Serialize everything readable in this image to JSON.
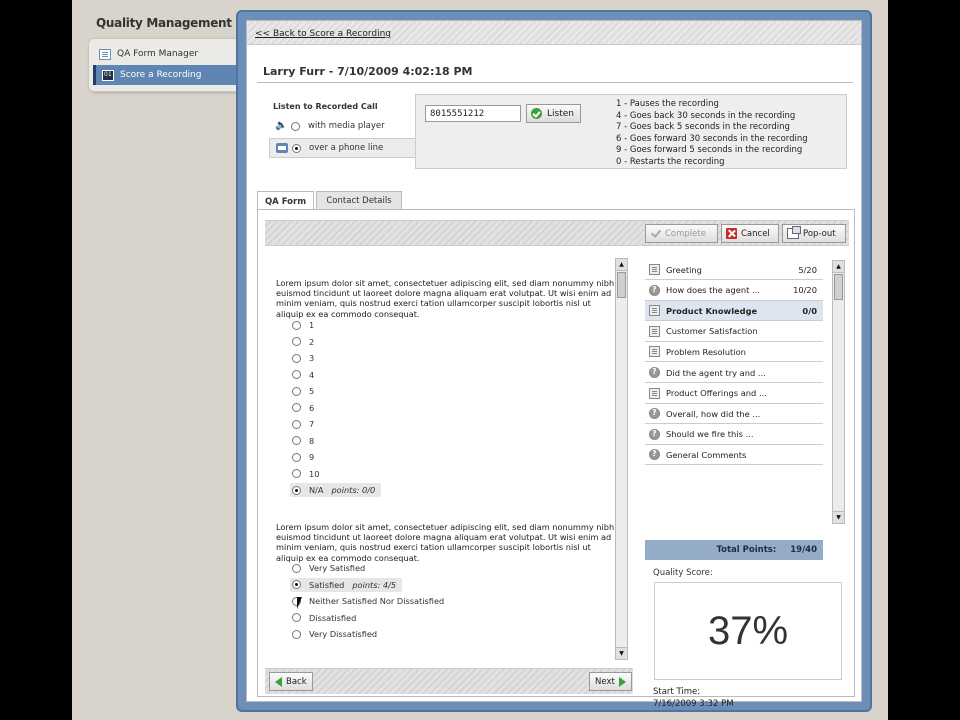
{
  "app": {
    "title": "Quality Management"
  },
  "nav": {
    "items": [
      {
        "label": "QA Form Manager",
        "active": false
      },
      {
        "label": "Score a Recording",
        "active": true
      }
    ]
  },
  "header": {
    "back_link": "<< Back to Score a Recording",
    "call_title": "Larry Furr - 7/10/2009 4:02:18 PM"
  },
  "listen": {
    "label": "Listen to  Recorded Call",
    "options": [
      {
        "label": "with media player",
        "selected": false
      },
      {
        "label": "over a phone line",
        "selected": true
      }
    ],
    "phone_number": "8015551212",
    "listen_button": "Listen",
    "keys": [
      "1 - Pauses the recording",
      "4 - Goes back 30 seconds in the recording",
      "7 - Goes back 5 seconds in the recording",
      "6 - Goes forward 30 seconds in the recording",
      "9 - Goes forward 5 seconds in the recording",
      "0 - Restarts the recording"
    ]
  },
  "tabs": [
    {
      "label": "QA Form",
      "active": true
    },
    {
      "label": "Contact Details",
      "active": false
    }
  ],
  "actions": {
    "complete": "Complete",
    "cancel": "Cancel",
    "popout": "Pop-out"
  },
  "questions": [
    {
      "text": "Lorem ipsum dolor sit amet, consectetuer adipiscing elit, sed diam nonummy nibh euismod tincidunt ut laoreet dolore magna aliquam erat volutpat. Ut wisi enim ad minim veniam, quis nostrud exerci tation ullamcorper suscipit lobortis nisl ut aliquip ex ea commodo consequat.",
      "answers": [
        "1",
        "2",
        "3",
        "4",
        "5",
        "6",
        "7",
        "8",
        "9",
        "10",
        "N/A"
      ],
      "selected_index": 10,
      "points": "points: 0/0"
    },
    {
      "text": "Lorem ipsum dolor sit amet, consectetuer adipiscing elit, sed diam nonummy nibh euismod tincidunt ut laoreet dolore magna aliquam erat volutpat. Ut wisi enim ad minim veniam, quis nostrud exerci tation ullamcorper suscipit lobortis nisl ut aliquip ex ea commodo consequat.",
      "answers": [
        "Very Satisfied",
        "Satisfied",
        "Neither Satisfied Nor Dissatisfied",
        "Dissatisfied",
        "Very Dissatisfied"
      ],
      "selected_index": 1,
      "points": "points: 4/5"
    }
  ],
  "sections": [
    {
      "name": "Greeting",
      "score": "5/20",
      "icon": "list-icon",
      "active": false
    },
    {
      "name": "How does the agent ...",
      "score": "10/20",
      "icon": "help-icon",
      "active": false
    },
    {
      "name": "Product Knowledge",
      "score": "0/0",
      "icon": "list-icon",
      "active": true
    },
    {
      "name": "Customer Satisfaction",
      "score": "",
      "icon": "list-icon",
      "active": false
    },
    {
      "name": "Problem Resolution",
      "score": "",
      "icon": "list-icon",
      "active": false
    },
    {
      "name": "Did the agent try and ...",
      "score": "",
      "icon": "help-icon",
      "active": false
    },
    {
      "name": "Product Offerings and ...",
      "score": "",
      "icon": "list-icon",
      "active": false
    },
    {
      "name": "Overall, how did the ...",
      "score": "",
      "icon": "help-icon",
      "active": false
    },
    {
      "name": "Should we fire this ...",
      "score": "",
      "icon": "help-icon",
      "active": false
    },
    {
      "name": "General Comments",
      "score": "",
      "icon": "help-icon",
      "active": false
    }
  ],
  "totals": {
    "label": "Total Points:",
    "value": "19/40"
  },
  "quality": {
    "label": "Quality Score:",
    "value": "37%"
  },
  "start": {
    "label": "Start Time:",
    "value": "7/16/2009 3:32 PM"
  },
  "pager": {
    "back": "Back",
    "next": "Next"
  }
}
